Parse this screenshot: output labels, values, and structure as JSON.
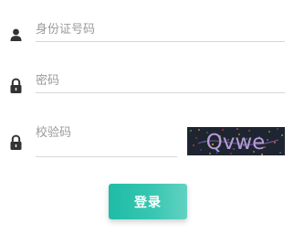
{
  "form": {
    "id_field": {
      "placeholder": "身份证号码",
      "value": "",
      "icon": "user-icon"
    },
    "password_field": {
      "placeholder": "密码",
      "value": "",
      "icon": "lock-icon"
    },
    "captcha_field": {
      "placeholder": "校验码",
      "value": "",
      "icon": "lock-icon"
    },
    "captcha_image": {
      "text": "Qvwe"
    },
    "login_button": {
      "label": "登录",
      "color": "#34c4ae"
    }
  }
}
